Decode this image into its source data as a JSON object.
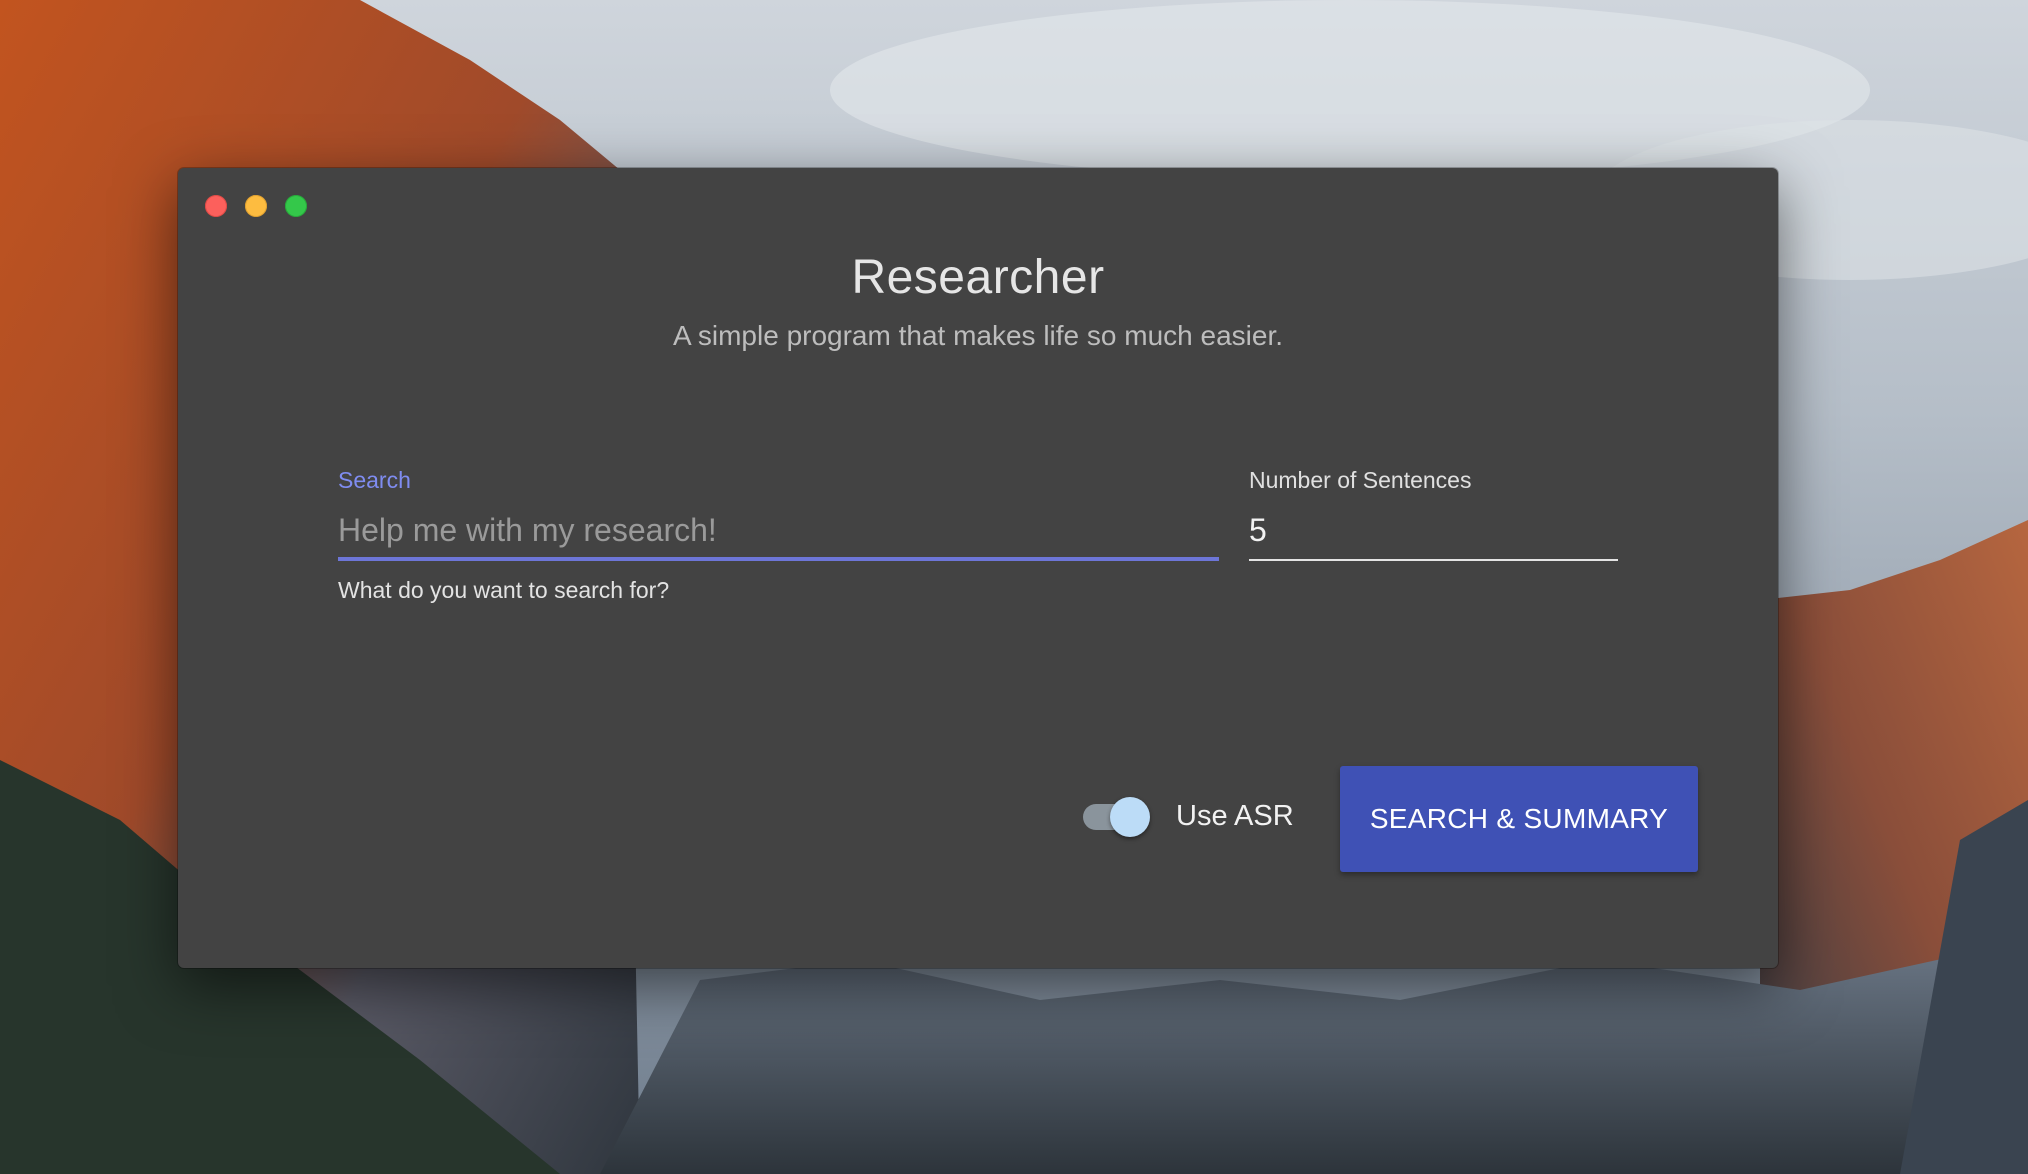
{
  "window": {
    "title": "Researcher",
    "subtitle": "A simple program that makes life so much easier."
  },
  "search": {
    "label": "Search",
    "placeholder": "Help me with my research!",
    "value": "",
    "helper": "What do you want to search for?"
  },
  "sentences": {
    "label": "Number of Sentences",
    "value": "5"
  },
  "asr_toggle": {
    "label": "Use ASR",
    "checked": true
  },
  "action": {
    "label": "SEARCH & SUMMARY"
  },
  "colors": {
    "window_bg": "#434343",
    "accent": "#3f51b5",
    "focus_label": "#7f8cf0",
    "toggle_thumb": "#bcdcf7",
    "close": "#fc605c",
    "minimize": "#fdbc40",
    "maximize": "#34c84a"
  }
}
